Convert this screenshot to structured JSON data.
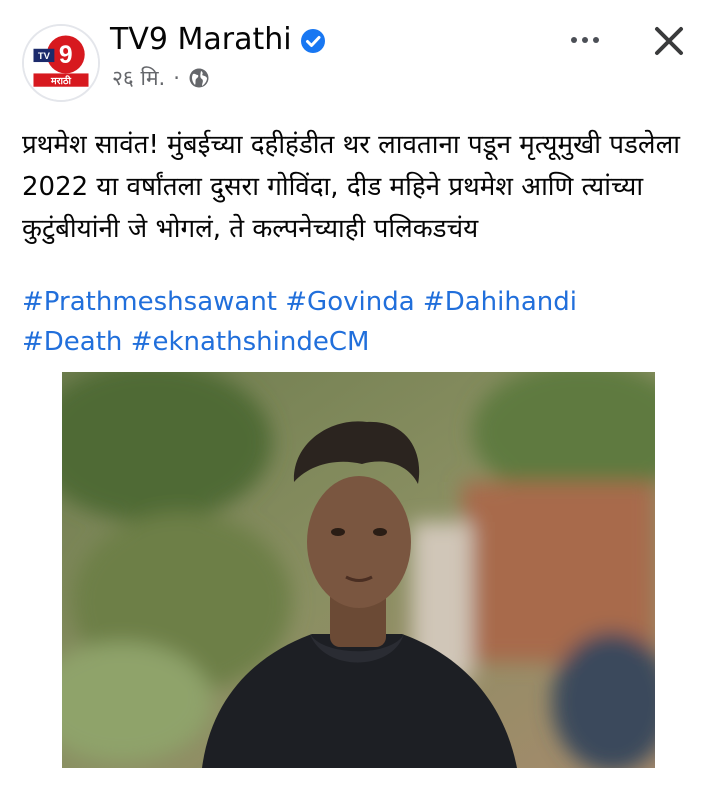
{
  "header": {
    "page_name": "TV9 Marathi",
    "timestamp": "२६ मि.",
    "separator": "·",
    "avatar_logo_text": "9",
    "avatar_sub_text": "मराठी",
    "avatar_tv_text": "TV"
  },
  "icons": {
    "verified": "verified-badge-icon",
    "globe": "globe-icon",
    "more": "more-options-icon",
    "close": "close-icon"
  },
  "post": {
    "text": "प्रथमेश सावंत! मुंबईच्या दहीहंडीत थर लावताना पडून मृत्यूमुखी पडलेला 2022 या वर्षांतला दुसरा गोविंदा, दीड महिने प्रथमेश आणि त्यांच्या कुटुंबीयांनी जे भोगलं, ते कल्पनेच्याही पलिकडचंय",
    "hashtags": [
      "#Prathmeshsawant",
      "#Govinda",
      "#Dahihandi",
      "#Death",
      "#eknathshindeCM"
    ]
  },
  "colors": {
    "link": "#216fdb",
    "verified": "#1877f2",
    "brand_red": "#d7191f",
    "meta_gray": "#65676b"
  }
}
